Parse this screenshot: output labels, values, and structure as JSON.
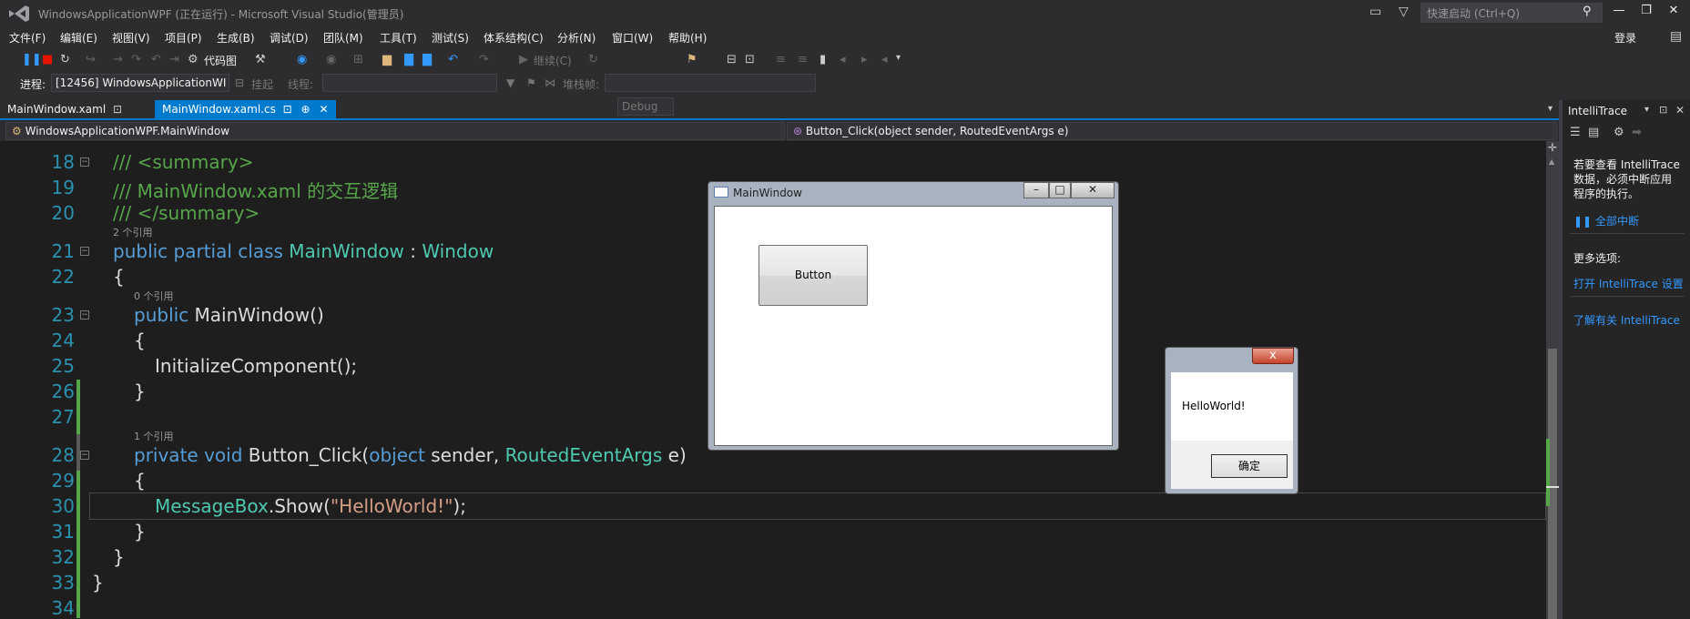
{
  "window": {
    "title": "WindowsApplicationWPF (正在运行) - Microsoft Visual Studio(管理员)",
    "quick_launch_placeholder": "快速启动 (Ctrl+Q)",
    "login": "登录"
  },
  "menu": [
    "文件(F)",
    "编辑(E)",
    "视图(V)",
    "项目(P)",
    "生成(B)",
    "调试(D)",
    "团队(M)",
    "工具(T)",
    "测试(S)",
    "体系结构(C)",
    "分析(N)",
    "窗口(W)",
    "帮助(H)"
  ],
  "toolbar": {
    "code_map": "代码图",
    "continue": "继续(C)",
    "config": "Debug"
  },
  "debug_bar": {
    "process_label": "进程:",
    "process_value": "[12456] WindowsApplicationWI",
    "suspend": "挂起",
    "thread_label": "线程:",
    "stack_label": "堆栈帧:"
  },
  "tabs": [
    {
      "label": "MainWindow.xaml",
      "active": false
    },
    {
      "label": "MainWindow.xaml.cs",
      "active": true
    }
  ],
  "nav": {
    "type_combo": "WindowsApplicationWPF.MainWindow",
    "member_combo": "Button_Click(object sender, RoutedEventArgs e)"
  },
  "code": {
    "line_numbers": [
      "18",
      "19",
      "20",
      "21",
      "22",
      "23",
      "24",
      "25",
      "26",
      "27",
      "28",
      "29",
      "30",
      "31",
      "32",
      "33",
      "34"
    ],
    "l18": "/// <summary>",
    "l19": "/// MainWindow.xaml 的交互逻辑",
    "l20": "/// </summary>",
    "lens21": "2 个引用",
    "l21_kw": "public partial class ",
    "l21_name": "MainWindow",
    "l21_sep": " : ",
    "l21_base": "Window",
    "l22": "{",
    "lens23": "0 个引用",
    "l23_kw": "public ",
    "l23_rest": "MainWindow()",
    "l24": "{",
    "l25": "InitializeComponent();",
    "l26": "}",
    "lens28": "1 个引用",
    "l28_kw": "private void ",
    "l28_name": "Button_Click(",
    "l28_kw2": "object",
    "l28_mid": " sender, ",
    "l28_ty": "RoutedEventArgs",
    "l28_end": " e)",
    "l29": "{",
    "l30_ty": "MessageBox",
    "l30_a": ".Show(",
    "l30_str": "\"HelloWorld!\"",
    "l30_b": ");",
    "l31": "}",
    "l32": "}",
    "l33": "}"
  },
  "intellitrace": {
    "title": "IntelliTrace",
    "msg1": "若要查看 IntelliTrace",
    "msg2": "数据，必须中断应用",
    "msg3": "程序的执行。",
    "break_all": "全部中断",
    "more_options": "更多选项:",
    "open_settings": "打开 IntelliTrace 设置",
    "learn_more": "了解有关 IntelliTrace"
  },
  "app_window": {
    "title": "MainWindow",
    "button": "Button"
  },
  "message_box": {
    "text": "HelloWorld!",
    "ok": "确定",
    "close": "x"
  },
  "colors": {
    "accent": "#007acc",
    "keyword": "#569cd6",
    "type": "#4ec9b0",
    "comment": "#57a64a",
    "string": "#d69d85",
    "line_number": "#2b91af"
  }
}
